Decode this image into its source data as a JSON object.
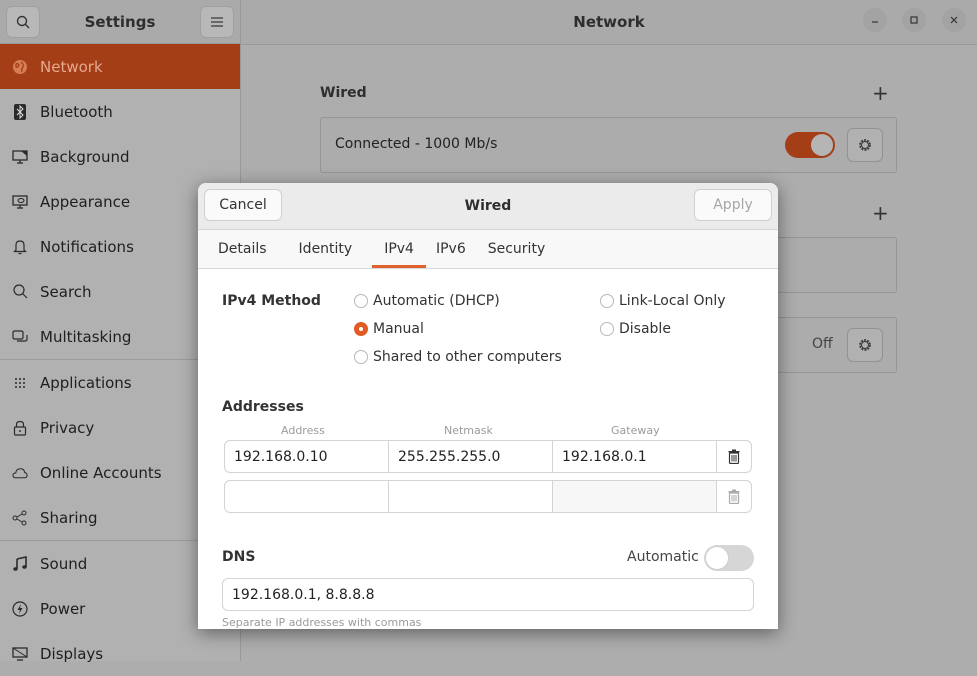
{
  "sidebar": {
    "title": "Settings",
    "items": [
      {
        "label": "Network",
        "icon": "globe-icon",
        "active": true
      },
      {
        "label": "Bluetooth",
        "icon": "bluetooth-icon"
      },
      {
        "label": "Background",
        "icon": "monitor-icon"
      },
      {
        "label": "Appearance",
        "icon": "appearance-icon"
      },
      {
        "label": "Notifications",
        "icon": "bell-icon"
      },
      {
        "label": "Search",
        "icon": "search-icon"
      },
      {
        "label": "Multitasking",
        "icon": "windows-icon"
      },
      {
        "label": "Applications",
        "icon": "grid-icon"
      },
      {
        "label": "Privacy",
        "icon": "lock-icon"
      },
      {
        "label": "Online Accounts",
        "icon": "cloud-icon"
      },
      {
        "label": "Sharing",
        "icon": "share-icon"
      },
      {
        "label": "Sound",
        "icon": "music-note-icon"
      },
      {
        "label": "Power",
        "icon": "power-icon"
      },
      {
        "label": "Displays",
        "icon": "display-icon"
      }
    ]
  },
  "main": {
    "title": "Network",
    "wired_section": "Wired",
    "wired_status": "Connected - 1000 Mb/s",
    "wired_enabled": true,
    "vpn_status": "Off"
  },
  "dialog": {
    "title": "Wired",
    "cancel_label": "Cancel",
    "apply_label": "Apply",
    "tabs": [
      "Details",
      "Identity",
      "IPv4",
      "IPv6",
      "Security"
    ],
    "active_tab": "IPv4",
    "method_label": "IPv4 Method",
    "methods": {
      "automatic": "Automatic (DHCP)",
      "manual": "Manual",
      "shared": "Shared to other computers",
      "link_local": "Link-Local Only",
      "disable": "Disable"
    },
    "selected_method": "Manual",
    "addresses_label": "Addresses",
    "columns": [
      "Address",
      "Netmask",
      "Gateway"
    ],
    "rows": [
      [
        "192.168.0.10",
        "255.255.255.0",
        "192.168.0.1"
      ],
      [
        "",
        "",
        ""
      ]
    ],
    "dns_label": "DNS",
    "dns_automatic_label": "Automatic",
    "dns_automatic": false,
    "dns_value": "192.168.0.1, 8.8.8.8",
    "dns_hint": "Separate IP addresses with commas"
  }
}
